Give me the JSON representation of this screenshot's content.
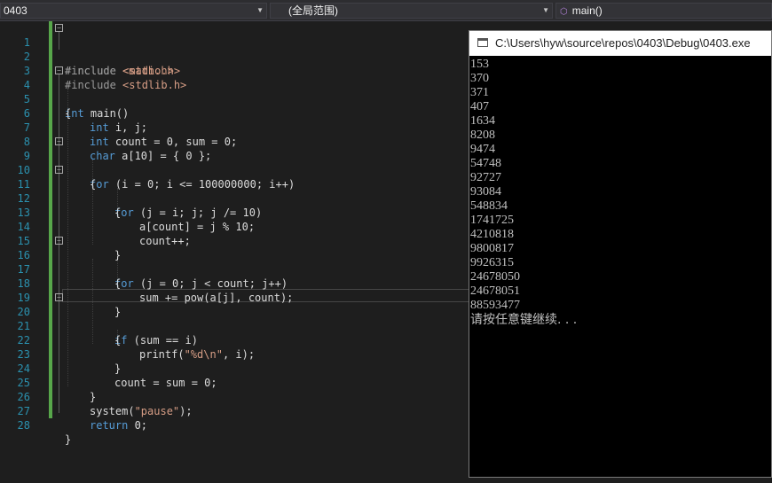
{
  "navbar": {
    "project": "0403",
    "scope": "(全局范围)",
    "function": "main()"
  },
  "editor": {
    "line_numbers": [
      "1",
      "2",
      "3",
      "4",
      "5",
      "6",
      "7",
      "8",
      "9",
      "10",
      "11",
      "12",
      "13",
      "14",
      "15",
      "16",
      "17",
      "18",
      "19",
      "20",
      "21",
      "22",
      "23",
      "24",
      "25",
      "26",
      "27",
      "28"
    ],
    "lines": {
      "l1a": "#include ",
      "l1b": "<stdio.h>",
      "l2a": "#include ",
      "l2b": "<math.h>",
      "l3a": "#include ",
      "l3b": "<stdlib.h>",
      "l4a": "int",
      "l4b": " main()",
      "l5": "{",
      "l6a": "int",
      "l6b": " i, j;",
      "l7a": "int",
      "l7b": " count = 0, sum = 0;",
      "l8a": "char",
      "l8b": " a[10] = { 0 };",
      "l9a": "for",
      "l9b": " (i = 0; i <= 100000000; i++)",
      "l10": "{",
      "l11a": "for",
      "l11b": " (j = i; j; j /= 10)",
      "l12": "{",
      "l13": "a[count] = j % 10;",
      "l14": "count++;",
      "l15": "}",
      "l16a": "for",
      "l16b": " (j = 0; j < count; j++)",
      "l17": "{",
      "l18": "sum += pow(a[j], count);",
      "l19": "}",
      "l20a": "if",
      "l20b": " (sum == i)",
      "l21": "{",
      "l22a": "printf(",
      "l22b": "\"%d\\n\"",
      "l22c": ", i);",
      "l23": "}",
      "l24": "count = sum = 0;",
      "l25": "}",
      "l26a": "system(",
      "l26b": "\"pause\"",
      "l26c": ");",
      "l27a": "return",
      "l27b": " 0;",
      "l28": "}"
    }
  },
  "console": {
    "title": "C:\\Users\\hyw\\source\\repos\\0403\\Debug\\0403.exe",
    "output": [
      "153",
      "370",
      "371",
      "407",
      "1634",
      "8208",
      "9474",
      "54748",
      "92727",
      "93084",
      "548834",
      "1741725",
      "4210818",
      "9800817",
      "9926315",
      "24678050",
      "24678051",
      "88593477"
    ],
    "prompt": "请按任意键继续. . ."
  }
}
